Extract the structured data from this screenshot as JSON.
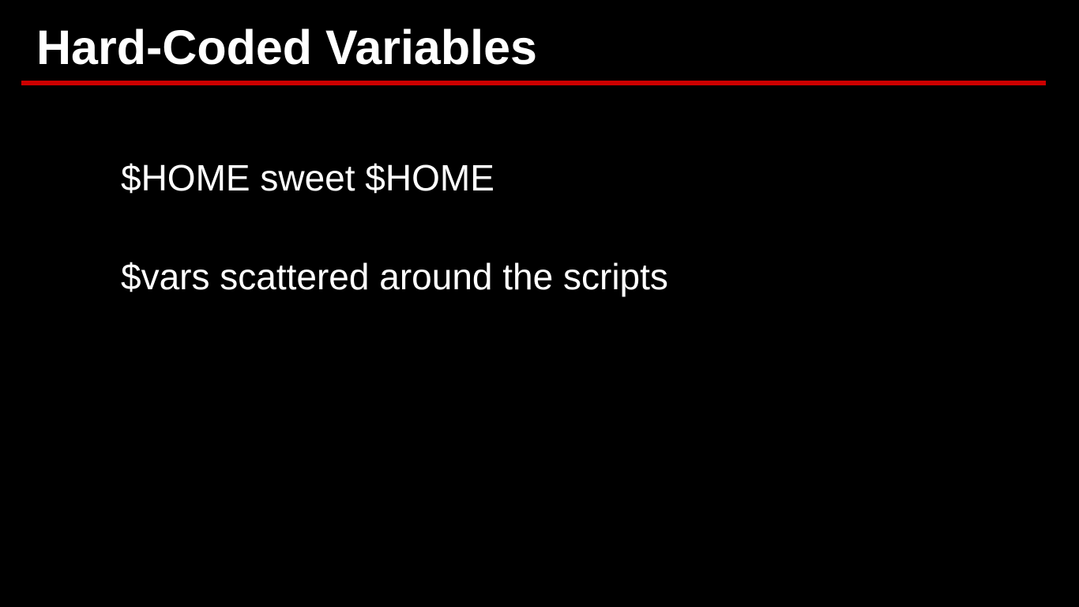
{
  "slide": {
    "title": "Hard-Coded Variables",
    "accent_color": "#cc0000",
    "background_color": "#000000",
    "text_color": "#ffffff",
    "bullets": [
      {
        "text": "$HOME sweet $HOME"
      },
      {
        "text": "$vars scattered around the scripts"
      }
    ]
  }
}
